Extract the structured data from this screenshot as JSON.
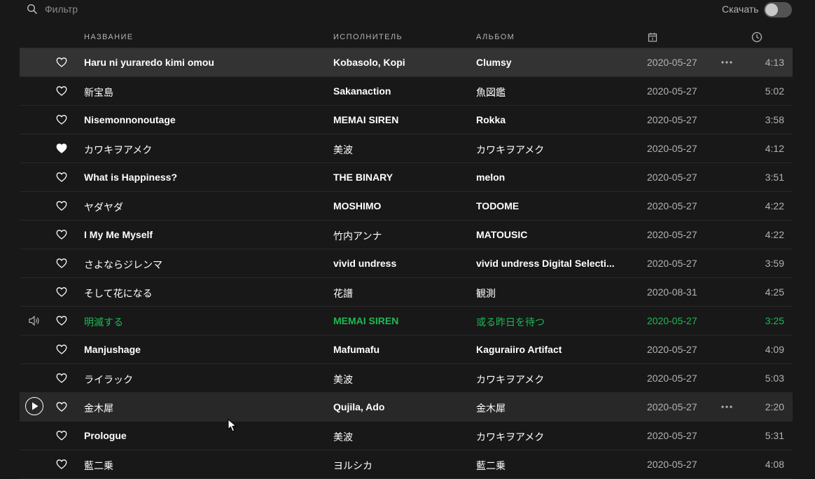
{
  "filter": {
    "placeholder": "Фильтр",
    "download_label": "Скачать",
    "download_enabled": false
  },
  "header": {
    "title": "НАЗВАНИЕ",
    "artist": "ИСПОЛНИТЕЛЬ",
    "album": "АЛЬБОМ",
    "date_icon": "calendar-icon",
    "duration_icon": "clock-icon"
  },
  "colors": {
    "background": "#181818",
    "row_hover": "#333333",
    "accent_playing": "#1db954",
    "text_primary": "#ffffff",
    "text_secondary": "#b3b3b3"
  },
  "tracks": [
    {
      "title": "Haru ni yuraredo kimi omou",
      "artist": "Kobasolo, Kopi",
      "album": "Clumsy",
      "date": "2020-05-27",
      "duration": "4:13",
      "liked": false,
      "state": "hover"
    },
    {
      "title": "新宝島",
      "artist": "Sakanaction",
      "album": "魚図鑑",
      "date": "2020-05-27",
      "duration": "5:02",
      "liked": false,
      "state": "normal"
    },
    {
      "title": "Nisemonnonoutage",
      "artist": "MEMAI SIREN",
      "album": "Rokka",
      "date": "2020-05-27",
      "duration": "3:58",
      "liked": false,
      "state": "normal"
    },
    {
      "title": "カワキヲアメク",
      "artist": "美波",
      "album": "カワキヲアメク",
      "date": "2020-05-27",
      "duration": "4:12",
      "liked": true,
      "state": "normal"
    },
    {
      "title": "What is Happiness?",
      "artist": "THE BINARY",
      "album": "melon",
      "date": "2020-05-27",
      "duration": "3:51",
      "liked": false,
      "state": "normal"
    },
    {
      "title": "ヤダヤダ",
      "artist": "MOSHIMO",
      "album": "TODOME",
      "date": "2020-05-27",
      "duration": "4:22",
      "liked": false,
      "state": "normal"
    },
    {
      "title": "I My Me Myself",
      "artist": "竹内アンナ",
      "album": "MATOUSIC",
      "date": "2020-05-27",
      "duration": "4:22",
      "liked": false,
      "state": "normal"
    },
    {
      "title": "さよならジレンマ",
      "artist": "vivid undress",
      "album": "vivid undress Digital Selecti...",
      "date": "2020-05-27",
      "duration": "3:59",
      "liked": false,
      "state": "normal"
    },
    {
      "title": "そして花になる",
      "artist": "花譜",
      "album": "観測",
      "date": "2020-08-31",
      "duration": "4:25",
      "liked": false,
      "state": "normal"
    },
    {
      "title": "明滅する",
      "artist": "MEMAI SIREN",
      "album": "或る昨日を待つ",
      "date": "2020-05-27",
      "duration": "3:25",
      "liked": false,
      "state": "playing"
    },
    {
      "title": "Manjushage",
      "artist": "Mafumafu",
      "album": "Kaguraiiro Artifact",
      "date": "2020-05-27",
      "duration": "4:09",
      "liked": false,
      "state": "normal"
    },
    {
      "title": "ライラック",
      "artist": "美波",
      "album": "カワキヲアメク",
      "date": "2020-05-27",
      "duration": "5:03",
      "liked": false,
      "state": "normal"
    },
    {
      "title": "金木犀",
      "artist": "Qujila, Ado",
      "album": "金木犀",
      "date": "2020-05-27",
      "duration": "2:20",
      "liked": false,
      "state": "selected"
    },
    {
      "title": "Prologue",
      "artist": "美波",
      "album": "カワキヲアメク",
      "date": "2020-05-27",
      "duration": "5:31",
      "liked": false,
      "state": "normal"
    },
    {
      "title": "藍二乗",
      "artist": "ヨルシカ",
      "album": "藍二乗",
      "date": "2020-05-27",
      "duration": "4:08",
      "liked": false,
      "state": "normal"
    }
  ]
}
